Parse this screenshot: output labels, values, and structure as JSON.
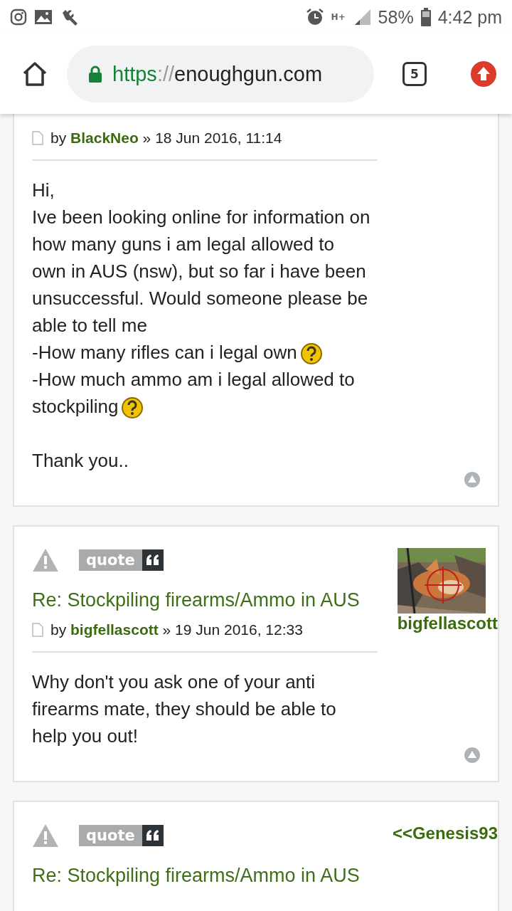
{
  "status_bar": {
    "network": "H+",
    "battery": "58%",
    "time": "4:42 pm"
  },
  "address_bar": {
    "scheme": "https",
    "separator": "://",
    "host": "enoughgun.com",
    "tab_count": "5"
  },
  "posts": [
    {
      "by": "by",
      "author": "BlackNeo",
      "separator": "»",
      "date": "18 Jun 2016, 11:14",
      "body": [
        {
          "lines": [
            {
              "text": "Hi,"
            },
            {
              "text": "Ive been looking online for information on how many guns i am legal allowed to own in AUS (nsw), but so far i have been unsuccessful. Would someone please be able to tell me"
            },
            {
              "text": "-How many rifles can i legal own",
              "smiley": true
            },
            {
              "text": "-How much ammo am i legal allowed to",
              "smiley": false
            },
            {
              "text": "stockpiling",
              "smiley": true
            }
          ]
        },
        {
          "lines": [
            {
              "text": "Thank you.."
            }
          ]
        }
      ]
    },
    {
      "quote": "quote",
      "title": "Re: Stockpiling firearms/Ammo in AUS",
      "poster": {
        "name": "bigfellascott"
      },
      "by": "by",
      "author": "bigfellascott",
      "separator": "»",
      "date": "19 Jun 2016, 12:33",
      "body": [
        {
          "lines": [
            {
              "text": "Why don't you ask one of your anti firearms mate, they should be able to help you out!"
            }
          ]
        }
      ]
    },
    {
      "quote": "quote",
      "title": "Re: Stockpiling firearms/Ammo in AUS",
      "poster": {
        "name": "<<Genesis93"
      }
    }
  ]
}
